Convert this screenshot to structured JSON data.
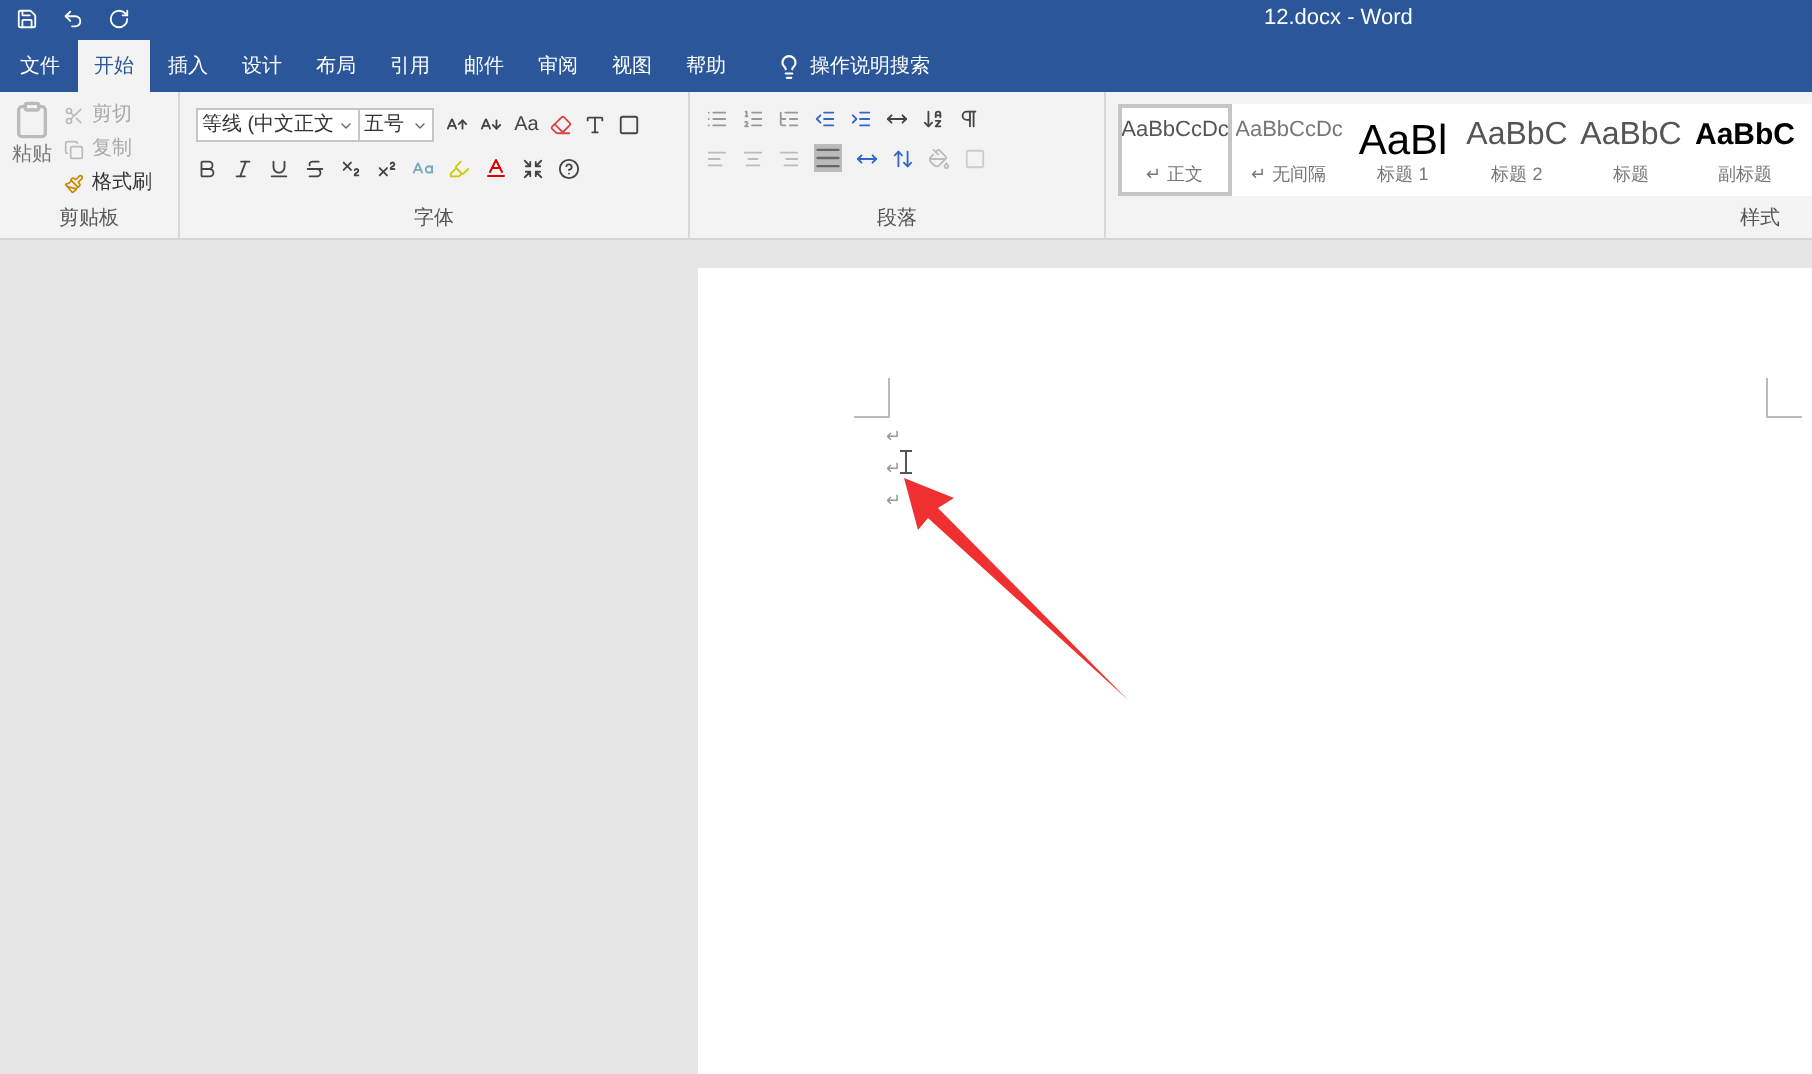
{
  "title_bar": {
    "title": "12.docx  -  Word"
  },
  "tabs": [
    {
      "label": "文件",
      "selected": false
    },
    {
      "label": "开始",
      "selected": true
    },
    {
      "label": "插入",
      "selected": false
    },
    {
      "label": "设计",
      "selected": false
    },
    {
      "label": "布局",
      "selected": false
    },
    {
      "label": "引用",
      "selected": false
    },
    {
      "label": "邮件",
      "selected": false
    },
    {
      "label": "审阅",
      "selected": false
    },
    {
      "label": "视图",
      "selected": false
    },
    {
      "label": "帮助",
      "selected": false
    }
  ],
  "tell_me": {
    "label": "操作说明搜索"
  },
  "clipboard": {
    "paste": {
      "label": "粘贴",
      "disabled": true
    },
    "items": [
      {
        "kind": "cut",
        "label": "剪切",
        "disabled": true
      },
      {
        "kind": "copy",
        "label": "复制",
        "disabled": true
      },
      {
        "kind": "format_painter",
        "label": "格式刷",
        "disabled": false
      }
    ],
    "group_label": "剪贴板"
  },
  "font": {
    "font_name": "等线 (中文正文",
    "font_size": "五号",
    "change_case": "Aa",
    "group_label": "字体"
  },
  "paragraph": {
    "group_label": "段落"
  },
  "styles": {
    "items": [
      {
        "kind": "normal",
        "preview": "AaBbCcDc",
        "name": "↵ 正文",
        "selected": true
      },
      {
        "kind": "no_spacing",
        "preview": "AaBbCcDc",
        "name": "↵ 无间隔",
        "selected": false
      },
      {
        "kind": "heading1",
        "preview": "AaBl",
        "name": "标题 1",
        "selected": false
      },
      {
        "kind": "heading2",
        "preview": "AaBbC",
        "name": "标题 2",
        "selected": false
      },
      {
        "kind": "title",
        "preview": "AaBbC",
        "name": "标题",
        "selected": false
      },
      {
        "kind": "subtitle",
        "preview": "AaBbC",
        "name": "副标题",
        "selected": false
      }
    ],
    "group_label": "样式"
  },
  "document": {
    "paragraphs": [
      "↵",
      "↵",
      "↵"
    ]
  }
}
